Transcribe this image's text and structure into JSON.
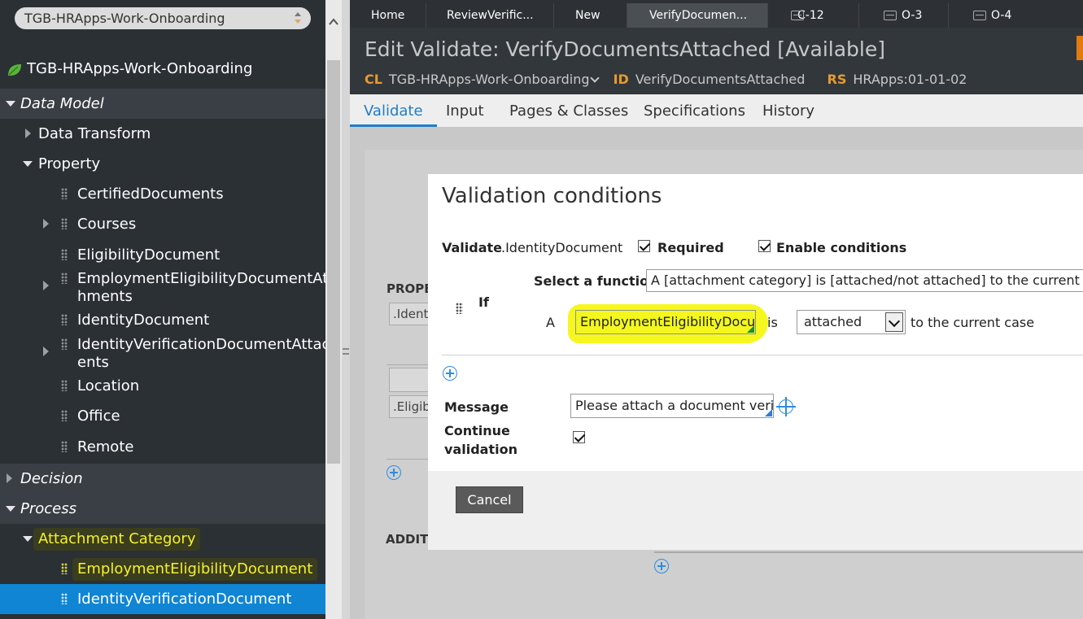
{
  "sidebar": {
    "app_selector": "TGB-HRApps-Work-Onboarding",
    "app_root": "TGB-HRApps-Work-Onboarding",
    "sections": {
      "data_model": "Data Model",
      "decision": "Decision",
      "process": "Process"
    },
    "items": {
      "data_transform": "Data Transform",
      "property": "Property",
      "certified_documents": "CertifiedDocuments",
      "courses": "Courses",
      "eligibility_document": "EligibilityDocument",
      "employment_attachments_l1": "EmploymentEligibilityDocumentAttac",
      "employment_attachments_l2": "hments",
      "identity_document": "IdentityDocument",
      "identity_verification_l1": "IdentityVerificationDocumentAttachm",
      "identity_verification_l2": "ents",
      "location": "Location",
      "office": "Office",
      "remote": "Remote",
      "attachment_category": "Attachment Category",
      "employment_eligibility_document": "EmploymentEligibilityDocument",
      "identity_verification_document": "IdentityVerificationDocument"
    }
  },
  "tabs": [
    {
      "label": "Home"
    },
    {
      "label": "ReviewVerific..."
    },
    {
      "label": "New"
    },
    {
      "label": "VerifyDocumen..."
    },
    {
      "label": "C-12"
    },
    {
      "label": "O-3"
    },
    {
      "label": "O-4"
    }
  ],
  "header": {
    "title": "Edit Validate: VerifyDocumentsAttached [Available]",
    "cl_key": "CL",
    "cl_value": "TGB-HRApps-Work-Onboarding",
    "id_key": "ID",
    "id_value": "VerifyDocumentsAttached",
    "rs_key": "RS",
    "rs_value": "HRApps:01-01-02"
  },
  "rule_tabs": [
    "Validate",
    "Input",
    "Pages & Classes",
    "Specifications",
    "History"
  ],
  "underlay": {
    "prop_label": "PROPE",
    "ident_value": ".Ident",
    "elig_value": ".Eligib",
    "addit_label": "ADDITI"
  },
  "modal": {
    "title": "Validation conditions",
    "validate_label": "Validate",
    "validate_property": ".IdentityDocument",
    "required_label": "Required",
    "enable_conditions_label": "Enable conditions",
    "if_label": "If",
    "select_function_label": "Select a function",
    "function_value": "A [attachment category] is [attached/not attached] to the current case",
    "a_label": "A",
    "category_value": "EmploymentEligibilityDocum",
    "is_label": "is",
    "attached_value": "attached",
    "suffix_text": "to the current case",
    "message_label": "Message",
    "message_value": "Please attach a document verify",
    "continue_label_l1": "Continue",
    "continue_label_l2": "validation",
    "cancel_label": "Cancel"
  },
  "colors": {
    "highlight": "#f6f12a",
    "selected": "#0f85d4",
    "accent": "#1f7dc9",
    "header_key": "#e89a2c"
  }
}
